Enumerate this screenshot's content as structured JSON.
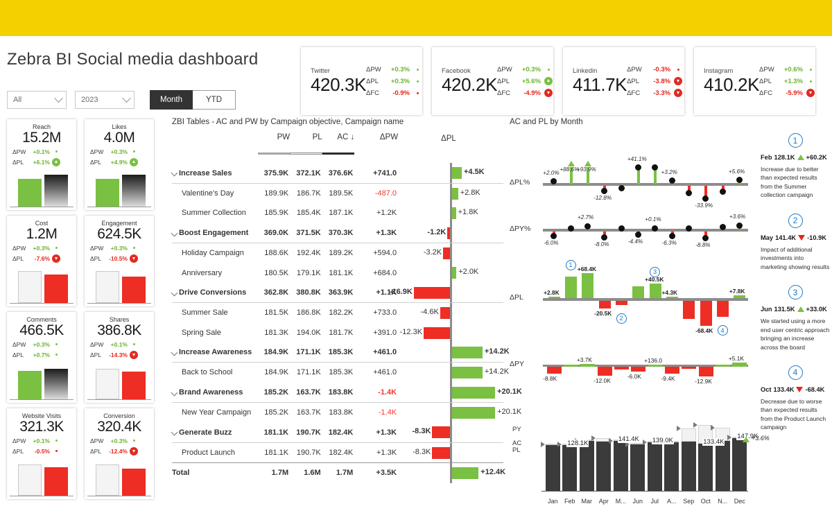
{
  "header": {
    "title": "Zebra BI Social media dashboard",
    "filters": {
      "scope": "All",
      "year": "2023",
      "month_label": "Month",
      "ytd_label": "YTD"
    }
  },
  "kpi_cards": [
    {
      "name": "Twitter",
      "value": "420.3K",
      "deltas": [
        {
          "label": "ΔPW",
          "value": "+0.3%",
          "sign": "pos",
          "icon": "flat-green"
        },
        {
          "label": "ΔPL",
          "value": "+0.3%",
          "sign": "pos",
          "icon": "flat-green"
        },
        {
          "label": "ΔFC",
          "value": "-0.9%",
          "sign": "neg",
          "icon": "flat-red"
        }
      ]
    },
    {
      "name": "Facebook",
      "value": "420.2K",
      "deltas": [
        {
          "label": "ΔPW",
          "value": "+0.3%",
          "sign": "pos",
          "icon": "flat-green"
        },
        {
          "label": "ΔPL",
          "value": "+5.6%",
          "sign": "pos",
          "icon": "arrow-up"
        },
        {
          "label": "ΔFC",
          "value": "-4.9%",
          "sign": "neg",
          "icon": "arrow-down"
        }
      ]
    },
    {
      "name": "Linkedin",
      "value": "411.7K",
      "deltas": [
        {
          "label": "ΔPW",
          "value": "-0.3%",
          "sign": "neg",
          "icon": "flat-red"
        },
        {
          "label": "ΔPL",
          "value": "-3.8%",
          "sign": "neg",
          "icon": "arrow-down"
        },
        {
          "label": "ΔFC",
          "value": "-3.3%",
          "sign": "neg",
          "icon": "arrow-down"
        }
      ]
    },
    {
      "name": "Instagram",
      "value": "410.2K",
      "deltas": [
        {
          "label": "ΔPW",
          "value": "+0.6%",
          "sign": "pos",
          "icon": "flat-green"
        },
        {
          "label": "ΔPL",
          "value": "+1.3%",
          "sign": "pos",
          "icon": "flat-green"
        },
        {
          "label": "ΔFC",
          "value": "-5.9%",
          "sign": "neg",
          "icon": "arrow-down"
        }
      ]
    }
  ],
  "metric_cards": [
    {
      "name": "Reach",
      "value": "15.2M",
      "deltas": [
        {
          "label": "ΔPW",
          "value": "+0.1%",
          "sign": "pos",
          "icon": "flat-green"
        },
        {
          "label": "ΔPL",
          "value": "+6.1%",
          "sign": "pos",
          "icon": "arrow-up"
        }
      ],
      "chart": {
        "primary": "green",
        "primary_h": 40,
        "secondary": "grad",
        "secondary_h": 46
      }
    },
    {
      "name": "Likes",
      "value": "4.0M",
      "deltas": [
        {
          "label": "ΔPW",
          "value": "+0.3%",
          "sign": "pos",
          "icon": "flat-green"
        },
        {
          "label": "ΔPL",
          "value": "+4.9%",
          "sign": "pos",
          "icon": "arrow-up"
        }
      ],
      "chart": {
        "primary": "green",
        "primary_h": 40,
        "secondary": "grad",
        "secondary_h": 46
      }
    },
    {
      "name": "Cost",
      "value": "1.2M",
      "deltas": [
        {
          "label": "ΔPW",
          "value": "+0.3%",
          "sign": "pos",
          "icon": "flat-green"
        },
        {
          "label": "ΔPL",
          "value": "-7.6%",
          "sign": "neg",
          "icon": "arrow-down"
        }
      ],
      "chart": {
        "primary": "hollow",
        "primary_h": 46,
        "secondary": "red",
        "secondary_h": 41
      }
    },
    {
      "name": "Engagement",
      "value": "624.5K",
      "deltas": [
        {
          "label": "ΔPW",
          "value": "+0.3%",
          "sign": "pos",
          "icon": "flat-green"
        },
        {
          "label": "ΔPL",
          "value": "-10.5%",
          "sign": "neg",
          "icon": "arrow-down"
        }
      ],
      "chart": {
        "primary": "hollow",
        "primary_h": 46,
        "secondary": "red",
        "secondary_h": 38
      }
    },
    {
      "name": "Comments",
      "value": "466.5K",
      "deltas": [
        {
          "label": "ΔPW",
          "value": "+0.3%",
          "sign": "pos",
          "icon": "flat-green"
        },
        {
          "label": "ΔPL",
          "value": "+0.7%",
          "sign": "pos",
          "icon": "flat-green"
        }
      ],
      "chart": {
        "primary": "green",
        "primary_h": 41,
        "secondary": "grad",
        "secondary_h": 44
      }
    },
    {
      "name": "Shares",
      "value": "386.8K",
      "deltas": [
        {
          "label": "ΔPW",
          "value": "+0.1%",
          "sign": "pos",
          "icon": "flat-green"
        },
        {
          "label": "ΔPL",
          "value": "-14.3%",
          "sign": "neg",
          "icon": "arrow-down"
        }
      ],
      "chart": {
        "primary": "hollow",
        "primary_h": 44,
        "secondary": "red",
        "secondary_h": 40
      }
    },
    {
      "name": "Website Visits",
      "value": "321.3K",
      "deltas": [
        {
          "label": "ΔPW",
          "value": "+0.1%",
          "sign": "pos",
          "icon": "flat-green"
        },
        {
          "label": "ΔPL",
          "value": "-0.5%",
          "sign": "neg",
          "icon": "flat-red"
        }
      ],
      "chart": {
        "primary": "hollow",
        "primary_h": 45,
        "secondary": "red",
        "secondary_h": 41
      }
    },
    {
      "name": "Conversion",
      "value": "320.4K",
      "deltas": [
        {
          "label": "ΔPW",
          "value": "+0.3%",
          "sign": "pos",
          "icon": "flat-green"
        },
        {
          "label": "ΔPL",
          "value": "-12.4%",
          "sign": "neg",
          "icon": "arrow-down"
        }
      ],
      "chart": {
        "primary": "hollow",
        "primary_h": 45,
        "secondary": "red",
        "secondary_h": 39
      }
    }
  ],
  "table": {
    "title": "ZBI Tables - AC and PW by Campaign objective, Campaign name",
    "columns": [
      "PW",
      "PL",
      "AC ↓",
      "ΔPW",
      "ΔPL"
    ],
    "rows": [
      {
        "type": "group",
        "label": "Increase Sales",
        "pw": "375.9K",
        "pl": "372.1K",
        "ac": "376.6K",
        "dpw": "+741.0",
        "dpw_neg": false,
        "dpl": "+4.5K",
        "dpl_val": 4.5
      },
      {
        "type": "child",
        "label": "Valentine's Day",
        "pw": "189.9K",
        "pl": "186.7K",
        "ac": "189.5K",
        "dpw": "-487.0",
        "dpw_neg": true,
        "dpl": "+2.8K",
        "dpl_val": 2.8
      },
      {
        "type": "child",
        "label": "Summer Collection",
        "pw": "185.9K",
        "pl": "185.4K",
        "ac": "187.1K",
        "dpw": "+1.2K",
        "dpw_neg": false,
        "dpl": "+1.8K",
        "dpl_val": 1.8
      },
      {
        "type": "group",
        "label": "Boost Engagement",
        "pw": "369.0K",
        "pl": "371.5K",
        "ac": "370.3K",
        "dpw": "+1.3K",
        "dpw_neg": false,
        "dpl": "-1.2K",
        "dpl_val": -1.2
      },
      {
        "type": "child",
        "label": "Holiday Campaign",
        "pw": "188.6K",
        "pl": "192.4K",
        "ac": "189.2K",
        "dpw": "+594.0",
        "dpw_neg": false,
        "dpl": "-3.2K",
        "dpl_val": -3.2
      },
      {
        "type": "child",
        "label": "Anniversary",
        "pw": "180.5K",
        "pl": "179.1K",
        "ac": "181.1K",
        "dpw": "+684.0",
        "dpw_neg": false,
        "dpl": "+2.0K",
        "dpl_val": 2.0
      },
      {
        "type": "group",
        "label": "Drive Conversions",
        "pw": "362.8K",
        "pl": "380.8K",
        "ac": "363.9K",
        "dpw": "+1.1K",
        "dpw_neg": false,
        "dpl": "-16.9K",
        "dpl_val": -16.9
      },
      {
        "type": "child",
        "label": "Summer Sale",
        "pw": "181.5K",
        "pl": "186.8K",
        "ac": "182.2K",
        "dpw": "+733.0",
        "dpw_neg": false,
        "dpl": "-4.6K",
        "dpl_val": -4.6
      },
      {
        "type": "child",
        "label": "Spring Sale",
        "pw": "181.3K",
        "pl": "194.0K",
        "ac": "181.7K",
        "dpw": "+391.0",
        "dpw_neg": false,
        "dpl": "-12.3K",
        "dpl_val": -12.3
      },
      {
        "type": "group",
        "label": "Increase Awareness",
        "pw": "184.9K",
        "pl": "171.1K",
        "ac": "185.3K",
        "dpw": "+461.0",
        "dpw_neg": false,
        "dpl": "+14.2K",
        "dpl_val": 14.2
      },
      {
        "type": "child",
        "label": "Back to School",
        "pw": "184.9K",
        "pl": "171.1K",
        "ac": "185.3K",
        "dpw": "+461.0",
        "dpw_neg": false,
        "dpl": "+14.2K",
        "dpl_val": 14.2
      },
      {
        "type": "group",
        "label": "Brand Awareness",
        "pw": "185.2K",
        "pl": "163.7K",
        "ac": "183.8K",
        "dpw": "-1.4K",
        "dpw_neg": true,
        "dpl": "+20.1K",
        "dpl_val": 20.1
      },
      {
        "type": "child",
        "label": "New Year Campaign",
        "pw": "185.2K",
        "pl": "163.7K",
        "ac": "183.8K",
        "dpw": "-1.4K",
        "dpw_neg": true,
        "dpl": "+20.1K",
        "dpl_val": 20.1
      },
      {
        "type": "group",
        "label": "Generate Buzz",
        "pw": "181.1K",
        "pl": "190.7K",
        "ac": "182.4K",
        "dpw": "+1.3K",
        "dpw_neg": false,
        "dpl": "-8.3K",
        "dpl_val": -8.3
      },
      {
        "type": "child",
        "label": "Product Launch",
        "pw": "181.1K",
        "pl": "190.7K",
        "ac": "182.4K",
        "dpw": "+1.3K",
        "dpw_neg": false,
        "dpl": "-8.3K",
        "dpl_val": -8.3
      },
      {
        "type": "total",
        "label": "Total",
        "pw": "1.7M",
        "pl": "1.6M",
        "ac": "1.7M",
        "dpw": "+3.5K",
        "dpw_neg": false,
        "dpl": "+12.4K",
        "dpl_val": 12.4
      }
    ]
  },
  "charts_title": "AC and PL by Month",
  "chart_data": [
    {
      "type": "line",
      "name": "dpl_pct",
      "title": "AC and PL by Month",
      "ylabel": "ΔPL%",
      "categories": [
        "Jan",
        "Feb",
        "Mar",
        "Apr",
        "M...",
        "Jun",
        "Jul",
        "A...",
        "Sep",
        "Oct",
        "N...",
        "Dec"
      ],
      "values": [
        2.0,
        88.6,
        93.9,
        -12.8,
        -5.0,
        41.1,
        41.1,
        3.2,
        -20.0,
        -33.9,
        -15.0,
        5.6
      ],
      "labels": [
        "+2.0%",
        "+88.6%",
        "+93.9%",
        "-12.8%",
        "",
        "+41.1%",
        "",
        "+3.2%",
        "",
        "-33.9%",
        "",
        "+5.6%"
      ],
      "overflow_markers": [
        1,
        2
      ]
    },
    {
      "type": "line",
      "name": "dpy_pct",
      "ylabel": "ΔPY%",
      "categories": [
        "Jan",
        "Feb",
        "Mar",
        "Apr",
        "M...",
        "Jun",
        "Jul",
        "A...",
        "Sep",
        "Oct",
        "N...",
        "Dec"
      ],
      "values": [
        -6.0,
        0.0,
        2.7,
        -8.0,
        0.0,
        -4.4,
        0.1,
        -6.3,
        0.0,
        -8.8,
        2.0,
        3.6
      ],
      "labels": [
        "-6.0%",
        "",
        "+2.7%",
        "-8.0%",
        "",
        "-4.4%",
        "+0.1%",
        "-6.3%",
        "",
        "-8.8%",
        "",
        "+3.6%"
      ]
    },
    {
      "type": "bar",
      "name": "dpl_abs",
      "ylabel": "ΔPL",
      "categories": [
        "Jan",
        "Feb",
        "Mar",
        "Apr",
        "M...",
        "Jun",
        "Jul",
        "A...",
        "Sep",
        "Oct",
        "N...",
        "Dec"
      ],
      "values": [
        2.8,
        60.2,
        68.4,
        -20.5,
        -10.9,
        33.0,
        40.5,
        4.3,
        -50.0,
        -68.4,
        -45.0,
        7.8
      ],
      "labels": [
        "+2.8K",
        "",
        "+68.4K",
        "-20.5K",
        "",
        "",
        "+40.5K",
        "+4.3K",
        "",
        "-68.4K",
        "",
        "+7.8K"
      ],
      "annotations": [
        {
          "n": "1",
          "index": 1
        },
        {
          "n": "2",
          "index": 4
        },
        {
          "n": "3",
          "index": 6
        },
        {
          "n": "4",
          "index": 10
        }
      ]
    },
    {
      "type": "bar",
      "name": "dpy_abs",
      "ylabel": "ΔPY",
      "categories": [
        "Jan",
        "Feb",
        "Mar",
        "Apr",
        "M...",
        "Jun",
        "Jul",
        "A...",
        "Sep",
        "Oct",
        "N...",
        "Dec"
      ],
      "values": [
        -8.8,
        1.5,
        3.7,
        -12.0,
        -4.0,
        -6.0,
        1.0,
        -9.4,
        -3.0,
        -12.9,
        3.0,
        5.1
      ],
      "labels": [
        "-8.8K",
        "",
        "+3.7K",
        "-12.0K",
        "",
        "-6.0K",
        "+136.0",
        "-9.4K",
        "",
        "-12.9K",
        "",
        "+5.1K"
      ]
    },
    {
      "type": "bar",
      "name": "ac_pl_py_by_month",
      "series": [
        {
          "name": "AC",
          "values": [
            128.0,
            128.1,
            141.0,
            139.0,
            141.4,
            130.0,
            136.0,
            137.0,
            139.0,
            133.4,
            140.0,
            147.9
          ]
        },
        {
          "name": "PY",
          "values": [
            130.0,
            131.0,
            141.0,
            148.0,
            141.4,
            131.0,
            136.0,
            137.0,
            175.0,
            185.0,
            178.0,
            150.0
          ]
        },
        {
          "name": "PL",
          "values": [
            128.0,
            95.0,
            95.0,
            139.0,
            141.4,
            115.0,
            116.0,
            137.0,
            139.0,
            133.4,
            140.0,
            147.9
          ]
        }
      ],
      "categories": [
        "Jan",
        "Feb",
        "Mar",
        "Apr",
        "M...",
        "Jun",
        "Jul",
        "A...",
        "Sep",
        "Oct",
        "N...",
        "Dec"
      ],
      "row_labels": [
        "PY",
        "AC",
        "PL"
      ],
      "value_labels": [
        {
          "index": 1,
          "text": "128.1K"
        },
        {
          "index": 4,
          "text": "141.4K"
        },
        {
          "index": 6,
          "text": "139.0K"
        },
        {
          "index": 9,
          "text": "133.4K"
        },
        {
          "index": 11,
          "text": "147.9K"
        }
      ],
      "total_delta": "+3.6%"
    }
  ],
  "notes": [
    {
      "n": "1",
      "month": "Feb",
      "value": "128.1K",
      "dir": "up",
      "delta": "+60.2K",
      "body": "Increase due to better than expected results from the Summer collection campaign"
    },
    {
      "n": "2",
      "month": "May",
      "value": "141.4K",
      "dir": "down",
      "delta": "-10.9K",
      "body": "Impact of additional investments into marketing showing results"
    },
    {
      "n": "3",
      "month": "Jun",
      "value": "131.5K",
      "dir": "up",
      "delta": "+33.0K",
      "body": "We started using a more end user centric approach bringing an increase across the board"
    },
    {
      "n": "4",
      "month": "Oct",
      "value": "133.4K",
      "dir": "down",
      "delta": "-68.4K",
      "body": "Decrease due to worse than expected results from the Product Launch campaign"
    }
  ],
  "colors": {
    "positive": "#7ac043",
    "negative": "#ee2d24",
    "accent": "#1f77c4",
    "brand": "#F5D000",
    "dark": "#3b3b3b"
  }
}
